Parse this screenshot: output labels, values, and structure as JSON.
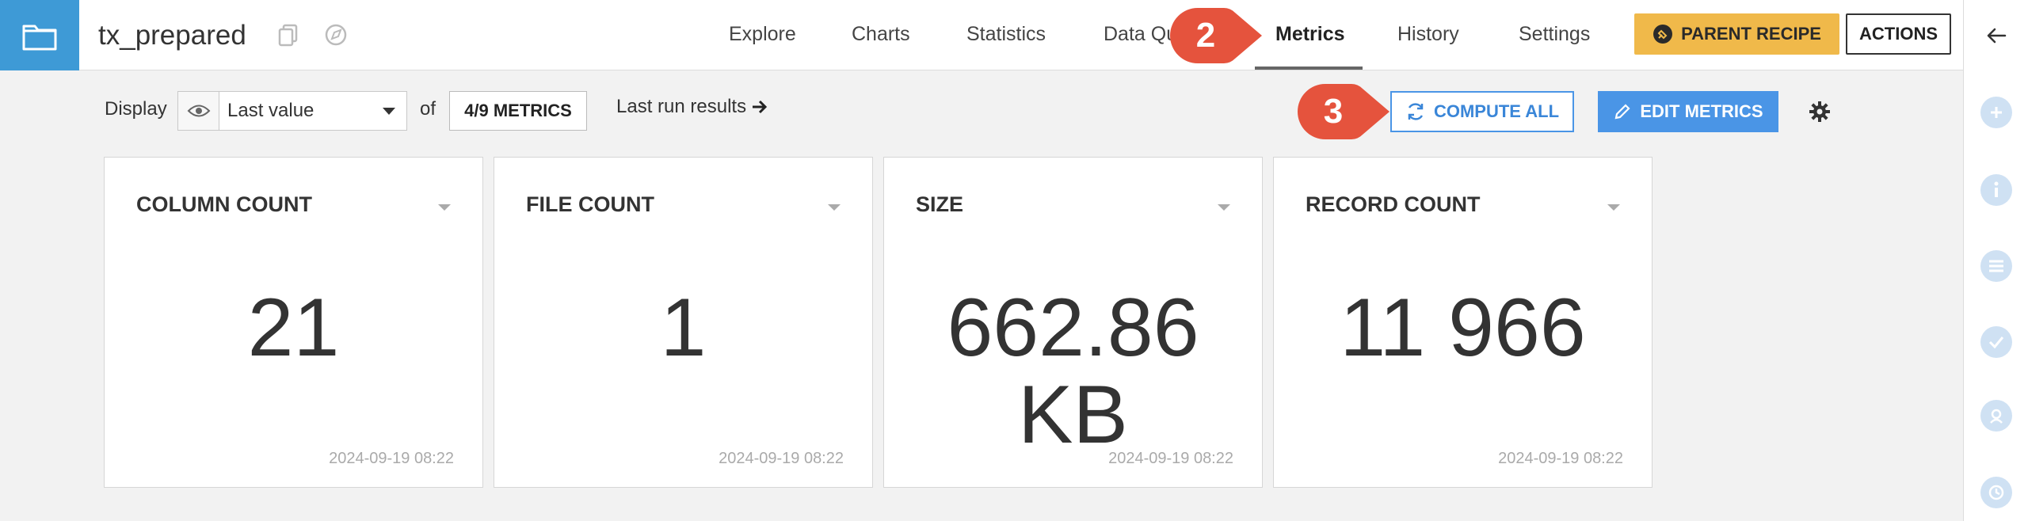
{
  "header": {
    "dataset_name": "tx_prepared",
    "tabs": [
      {
        "label": "Explore"
      },
      {
        "label": "Charts"
      },
      {
        "label": "Statistics"
      },
      {
        "label": "Data Qu"
      },
      {
        "label": "Metrics",
        "active": true
      },
      {
        "label": "History"
      },
      {
        "label": "Settings"
      }
    ],
    "parent_recipe_label": "PARENT RECIPE",
    "actions_label": "ACTIONS"
  },
  "toolbar": {
    "display_label": "Display",
    "display_select_value": "Last value",
    "of_label": "of",
    "metrics_count_label": "4/9 METRICS",
    "last_run_label": "Last run results",
    "compute_all_label": "COMPUTE ALL",
    "edit_metrics_label": "EDIT METRICS"
  },
  "callouts": [
    {
      "number": "2"
    },
    {
      "number": "3"
    }
  ],
  "metrics": [
    {
      "title": "COLUMN COUNT",
      "value": "21",
      "date": "2024-09-19 08:22"
    },
    {
      "title": "FILE COUNT",
      "value": "1",
      "date": "2024-09-19 08:22"
    },
    {
      "title": "SIZE",
      "value": "662.86 KB",
      "date": "2024-09-19 08:22"
    },
    {
      "title": "RECORD COUNT",
      "value": "11 966",
      "date": "2024-09-19 08:22"
    }
  ],
  "sidebar_icons": [
    "back-arrow-icon",
    "plus-icon",
    "info-icon",
    "list-icon",
    "check-icon",
    "discussion-icon",
    "clock-icon"
  ],
  "colors": {
    "accent_blue": "#4a95e6",
    "dataset_tile": "#3e9ad6",
    "parent_recipe": "#f0b94a",
    "callout_red": "#e5533d"
  }
}
